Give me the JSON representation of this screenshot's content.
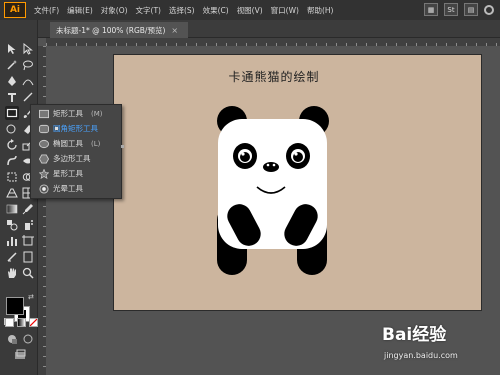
{
  "app": {
    "logo": "Ai"
  },
  "menu": [
    "文件(F)",
    "编辑(E)",
    "对象(O)",
    "文字(T)",
    "选择(S)",
    "效果(C)",
    "视图(V)",
    "窗口(W)",
    "帮助(H)"
  ],
  "menubar_right": {
    "st_label": "St"
  },
  "document_tab": {
    "title": "未标题-1* @ 100% (RGB/预览)",
    "close": "×"
  },
  "flyout": {
    "items": [
      {
        "label": "矩形工具",
        "shortcut": "(M)",
        "icon": "rectangle-icon",
        "selected": false
      },
      {
        "label": "圆角矩形工具",
        "shortcut": "",
        "icon": "rounded-rectangle-icon",
        "selected": true
      },
      {
        "label": "椭圆工具",
        "shortcut": "(L)",
        "icon": "ellipse-icon",
        "selected": false
      },
      {
        "label": "多边形工具",
        "shortcut": "",
        "icon": "polygon-icon",
        "selected": false
      },
      {
        "label": "星形工具",
        "shortcut": "",
        "icon": "star-icon",
        "selected": false
      },
      {
        "label": "光晕工具",
        "shortcut": "",
        "icon": "flare-icon",
        "selected": false
      }
    ]
  },
  "artboard": {
    "title": "卡通熊猫的绘制",
    "background": "#ccb59e"
  },
  "colors": {
    "fill": "#000000",
    "stroke": "#ffffff",
    "accent": "#ff9a00",
    "selected_text": "#4aa3ff"
  },
  "watermark": {
    "brand": "Bai经验",
    "url": "jingyan.baidu.com"
  }
}
